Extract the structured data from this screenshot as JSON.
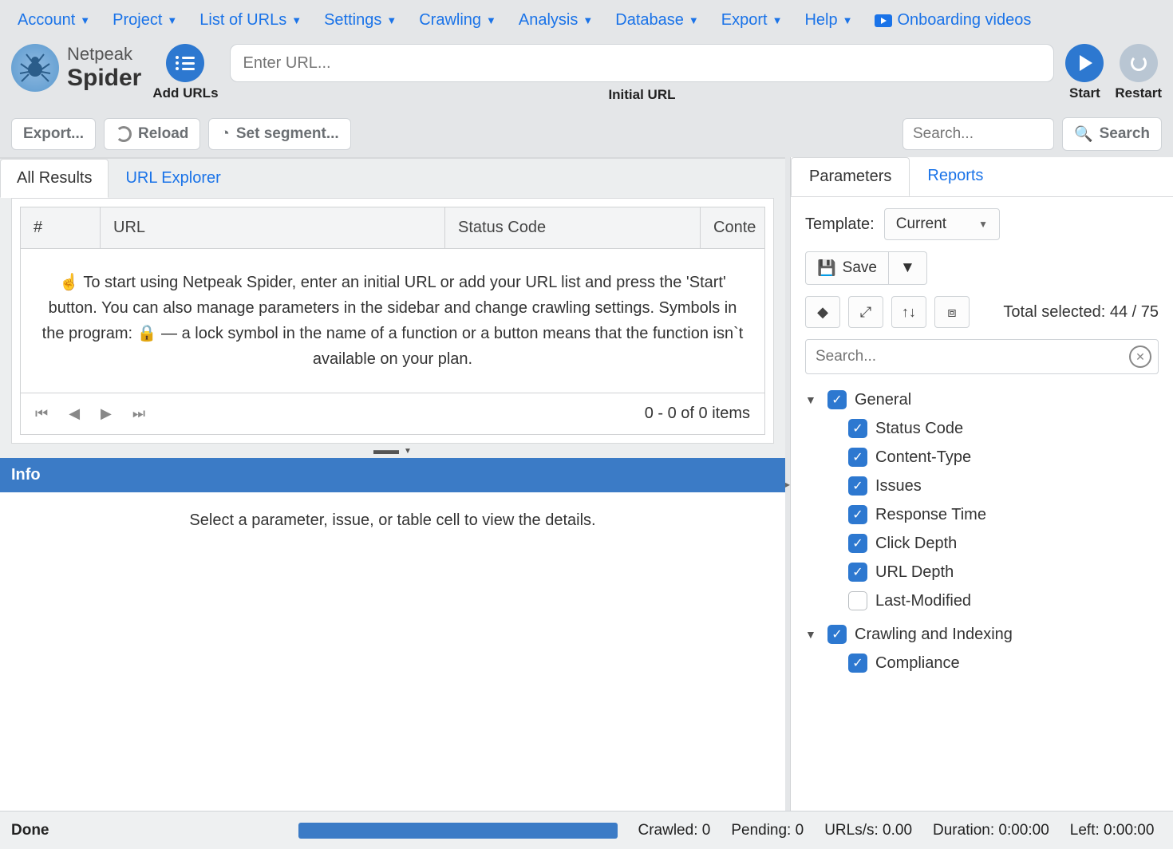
{
  "menubar": {
    "items": [
      {
        "label": "Account"
      },
      {
        "label": "Project"
      },
      {
        "label": "List of URLs"
      },
      {
        "label": "Settings"
      },
      {
        "label": "Crawling"
      },
      {
        "label": "Analysis"
      },
      {
        "label": "Database"
      },
      {
        "label": "Export"
      },
      {
        "label": "Help"
      }
    ],
    "videos_label": "Onboarding videos"
  },
  "brand": {
    "line1": "Netpeak",
    "line2": "Spider"
  },
  "header": {
    "add_urls_label": "Add URLs",
    "url_placeholder": "Enter URL...",
    "url_caption": "Initial URL",
    "start_label": "Start",
    "restart_label": "Restart"
  },
  "toolbar": {
    "export_label": "Export...",
    "reload_label": "Reload",
    "segment_label": "Set segment...",
    "search_placeholder": "Search...",
    "search_button": "Search"
  },
  "left": {
    "tabs": {
      "all_results": "All Results",
      "url_explorer": "URL Explorer"
    },
    "columns": {
      "num": "#",
      "url": "URL",
      "status": "Status Code",
      "content": "Conte"
    },
    "hint": "To start using Netpeak Spider, enter an initial URL or add your URL list and press the 'Start' button. You can also manage parameters in the sidebar and change crawling settings. Symbols in the program: 🔒  — a lock symbol in the name of a function or a button means that the function isn`t available on your plan.",
    "pager_info": "0 - 0 of 0 items",
    "info_title": "Info",
    "info_body": "Select a parameter, issue, or table cell to view the details."
  },
  "right": {
    "tabs": {
      "parameters": "Parameters",
      "reports": "Reports"
    },
    "template_label": "Template:",
    "template_value": "Current",
    "save_label": "Save",
    "total_selected_label": "Total selected: 44 / 75",
    "param_search_placeholder": "Search...",
    "tree": [
      {
        "label": "General",
        "checked": true,
        "children": [
          {
            "label": "Status Code",
            "checked": true
          },
          {
            "label": "Content-Type",
            "checked": true
          },
          {
            "label": "Issues",
            "checked": true
          },
          {
            "label": "Response Time",
            "checked": true
          },
          {
            "label": "Click Depth",
            "checked": true
          },
          {
            "label": "URL Depth",
            "checked": true
          },
          {
            "label": "Last-Modified",
            "checked": false
          }
        ]
      },
      {
        "label": "Crawling and Indexing",
        "checked": true,
        "children": [
          {
            "label": "Compliance",
            "checked": true
          }
        ]
      }
    ]
  },
  "statusbar": {
    "done": "Done",
    "crawled": "Crawled: 0",
    "pending": "Pending: 0",
    "urls_per_s": "URLs/s: 0.00",
    "duration": "Duration: 0:00:00",
    "left": "Left: 0:00:00"
  }
}
